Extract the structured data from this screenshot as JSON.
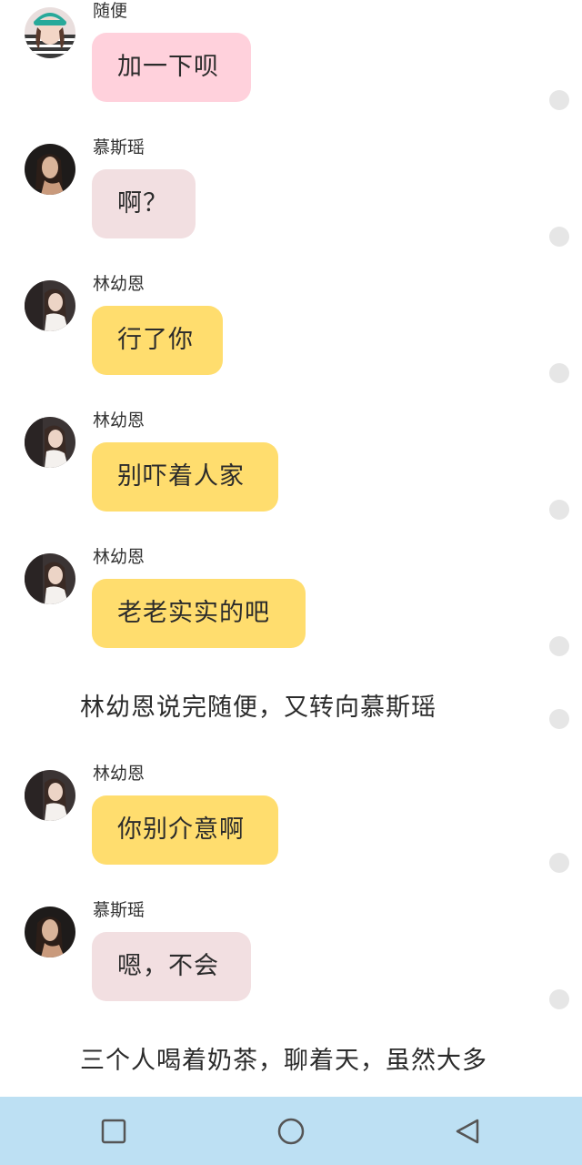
{
  "colors": {
    "pink_bubble": "#ffd1dc",
    "rose_bubble": "#f2dfe1",
    "yellow_bubble": "#ffdd6e",
    "nav_bar": "#bde0f3",
    "dot": "#e6e6e6"
  },
  "messages": [
    {
      "name": "随便",
      "text": "加一下呗"
    },
    {
      "name": "慕斯瑶",
      "text": "啊？"
    },
    {
      "name": "林幼恩",
      "text": "行了你"
    },
    {
      "name": "林幼恩",
      "text": "别吓着人家"
    },
    {
      "name": "林幼恩",
      "text": "老老实实的吧"
    },
    {
      "name": "林幼恩",
      "text": "你别介意啊"
    },
    {
      "name": "慕斯瑶",
      "text": "嗯，不会"
    }
  ],
  "narration": [
    "林幼恩说完随便，又转向慕斯瑶",
    "三个人喝着奶茶，聊着天，虽然大多"
  ],
  "navbar": {
    "icons": [
      "recent-apps-icon",
      "home-icon",
      "back-icon"
    ]
  }
}
